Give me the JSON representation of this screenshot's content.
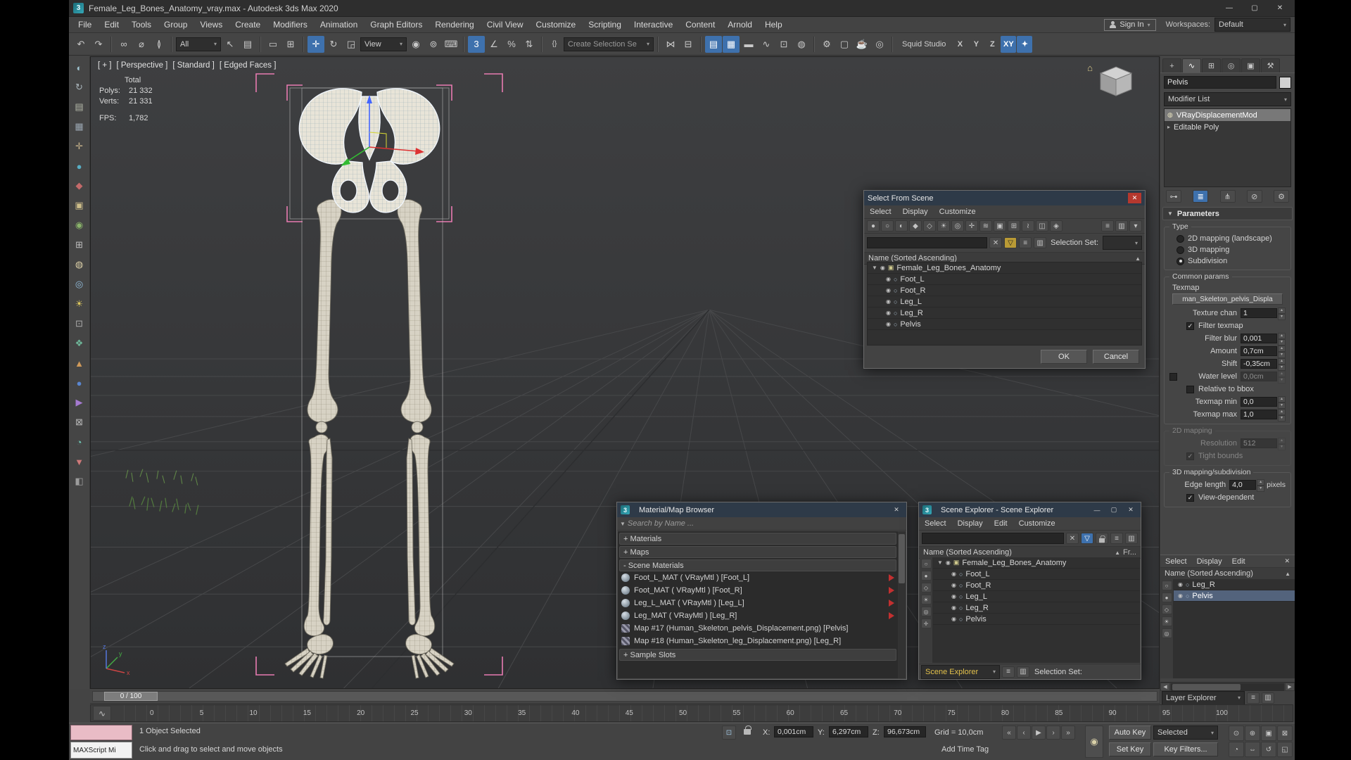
{
  "icons": {
    "eye": "◉",
    "obj": "○",
    "expand": "▼",
    "expand_right": "▸",
    "close": "✕",
    "min": "—",
    "max": "▢",
    "combo_arrow": "▾",
    "clear": "✕",
    "funnel": "▽",
    "check": "✓",
    "spin_up": "▴",
    "spin_down": "▾",
    "sort_asc": "▲",
    "hierarchy": "▣",
    "home": "⌂",
    "bulb": "◍",
    "hamburger": "≡",
    "columns": "▥",
    "left": "◀",
    "right": "▶",
    "braces": "{}",
    "curve": "∿",
    "app_badge": "3"
  },
  "titlebar": {
    "title": "Female_Leg_Bones_Anatomy_vray.max - Autodesk 3ds Max 2020"
  },
  "menubar": {
    "items": [
      "File",
      "Edit",
      "Tools",
      "Group",
      "Views",
      "Create",
      "Modifiers",
      "Animation",
      "Graph Editors",
      "Rendering",
      "Civil View",
      "Customize",
      "Scripting",
      "Interactive",
      "Content",
      "Arnold",
      "Help"
    ],
    "sign_in": "Sign In",
    "workspaces_label": "Workspaces:",
    "workspace": "Default"
  },
  "toolbar": {
    "history": [
      {
        "name": "undo-icon",
        "glyph": "↶"
      },
      {
        "name": "redo-icon",
        "glyph": "↷"
      }
    ],
    "link": [
      {
        "name": "select-and-link-icon",
        "glyph": "∞"
      },
      {
        "name": "unlink-selection-icon",
        "glyph": "⌀"
      },
      {
        "name": "bind-to-space-warp-icon",
        "glyph": "≬"
      }
    ],
    "selection_filter": "All",
    "select": [
      {
        "name": "select-object-icon",
        "glyph": "↖"
      },
      {
        "name": "select-by-name-icon",
        "glyph": "▤"
      }
    ],
    "region": [
      {
        "name": "rectangular-selection-icon",
        "glyph": "▭"
      },
      {
        "name": "window-crossing-icon",
        "glyph": "⊞"
      }
    ],
    "transform": [
      {
        "name": "select-and-move-icon",
        "glyph": "✛",
        "active": true
      },
      {
        "name": "select-and-rotate-icon",
        "glyph": "↻"
      },
      {
        "name": "select-and-scale-icon",
        "glyph": "◲"
      }
    ],
    "ref_coord": "View",
    "pivot": [
      {
        "name": "use-pivot-center-icon",
        "glyph": "◉"
      },
      {
        "name": "select-and-manipulate-icon",
        "glyph": "⊚"
      },
      {
        "name": "keyboard-override-icon",
        "glyph": "⌨"
      }
    ],
    "snaps": [
      {
        "name": "snap-toggle-3d-icon",
        "glyph": "3",
        "active": true
      },
      {
        "name": "angle-snap-icon",
        "glyph": "∠"
      },
      {
        "name": "percent-snap-icon",
        "glyph": "%"
      },
      {
        "name": "spinner-snap-icon",
        "glyph": "⇅"
      }
    ],
    "named_sets_glyph": "{}",
    "selection_set_placeholder": "Create Selection Se",
    "mirror_align": [
      {
        "name": "mirror-icon",
        "glyph": "⋈"
      },
      {
        "name": "align-icon",
        "glyph": "⊟"
      }
    ],
    "toggles": [
      {
        "name": "toggle-scene-explorer-icon",
        "glyph": "▤",
        "active": true
      },
      {
        "name": "toggle-layer-explorer-icon",
        "glyph": "▦",
        "active": true
      },
      {
        "name": "toggle-ribbon-icon",
        "glyph": "▬"
      },
      {
        "name": "curve-editor-icon",
        "glyph": "∿"
      },
      {
        "name": "schematic-view-icon",
        "glyph": "⊡"
      },
      {
        "name": "material-editor-icon",
        "glyph": "◍"
      }
    ],
    "render": [
      {
        "name": "render-setup-icon",
        "glyph": "⚙"
      },
      {
        "name": "rendered-frame-window-icon",
        "glyph": "▢"
      },
      {
        "name": "render-production-icon",
        "glyph": "☕"
      },
      {
        "name": "render-iterative-icon",
        "glyph": "◎"
      }
    ],
    "studio_label": "Squid Studio",
    "axis": [
      {
        "name": "axis-x-button",
        "label": "X"
      },
      {
        "name": "axis-y-button",
        "label": "Y"
      },
      {
        "name": "axis-z-button",
        "label": "Z"
      },
      {
        "name": "axis-xy-button",
        "label": "XY",
        "active": true
      },
      {
        "name": "axis-xyz-icon",
        "label": "✦",
        "active": true
      }
    ]
  },
  "left_tools": [
    {
      "name": "left-tool-select-icon",
      "glyph": "◐",
      "color": "#9fc3cf"
    },
    {
      "name": "left-tool-refresh-icon",
      "glyph": "↻",
      "color": "#a9b4ba"
    },
    {
      "name": "left-tool-layers-icon",
      "glyph": "▤",
      "color": "#b3b8a8"
    },
    {
      "name": "left-tool-grid-icon",
      "glyph": "▦",
      "color": "#9aa6b1"
    },
    {
      "name": "left-tool-add-icon",
      "glyph": "✛",
      "color": "#c3b089"
    },
    {
      "name": "left-tool-sphere-icon",
      "glyph": "●",
      "color": "#58aec4"
    },
    {
      "name": "left-tool-material-icon",
      "glyph": "◆",
      "color": "#c46a6a"
    },
    {
      "name": "left-tool-box-icon",
      "glyph": "▣",
      "color": "#cdbd8a"
    },
    {
      "name": "left-tool-target-icon",
      "glyph": "◉",
      "color": "#8ab46a"
    },
    {
      "name": "left-tool-window-icon",
      "glyph": "⊞",
      "color": "#bdbdbd"
    },
    {
      "name": "left-tool-render-icon",
      "glyph": "◍",
      "color": "#dcd0a8"
    },
    {
      "name": "left-tool-camera-icon",
      "glyph": "◎",
      "color": "#93bede"
    },
    {
      "name": "left-tool-light-icon",
      "glyph": "☀",
      "color": "#dec85e"
    },
    {
      "name": "left-tool-plane-icon",
      "glyph": "⊡",
      "color": "#ababab"
    },
    {
      "name": "left-tool-star-icon",
      "glyph": "❖",
      "color": "#6fb89a"
    },
    {
      "name": "left-tool-up-icon",
      "glyph": "▲",
      "color": "#d09a5a"
    },
    {
      "name": "left-tool-dot-icon",
      "glyph": "●",
      "color": "#5a86d0"
    },
    {
      "name": "left-tool-play-icon",
      "glyph": "▶",
      "color": "#a57ad0"
    },
    {
      "name": "left-tool-close-icon",
      "glyph": "⊠",
      "color": "#b8b8b8"
    },
    {
      "name": "left-tool-quarter-icon",
      "glyph": "◔",
      "color": "#72cfbc"
    },
    {
      "name": "left-tool-down-icon",
      "glyph": "▼",
      "color": "#cf7a7a"
    },
    {
      "name": "left-tool-half-icon",
      "glyph": "◧",
      "color": "#9c9c9c"
    }
  ],
  "viewport": {
    "label_plus": "[ + ]",
    "label_persp": "[ Perspective ]",
    "label_standard": "[ Standard ]",
    "label_edged": "[ Edged Faces ]",
    "stats_total_label": "Total",
    "stats_polys_label": "Polys:",
    "stats_polys": "21 332",
    "stats_verts_label": "Verts:",
    "stats_verts": "21 331",
    "stats_fps_label": "FPS:",
    "stats_fps": "1,782"
  },
  "dialogs": {
    "sfs": {
      "title": "Select From Scene",
      "menus": [
        "Select",
        "Display",
        "Customize"
      ],
      "toolbar": [
        {
          "name": "display-all-icon",
          "glyph": "●"
        },
        {
          "name": "display-none-icon",
          "glyph": "○"
        },
        {
          "name": "display-invert-icon",
          "glyph": "◐"
        },
        {
          "name": "display-geometry-icon",
          "glyph": "◆"
        },
        {
          "name": "display-shapes-icon",
          "glyph": "◇"
        },
        {
          "name": "display-lights-icon",
          "glyph": "☀"
        },
        {
          "name": "display-cameras-icon",
          "glyph": "◎"
        },
        {
          "name": "display-helpers-icon",
          "glyph": "✛"
        },
        {
          "name": "display-space-warps-icon",
          "glyph": "≋"
        },
        {
          "name": "display-groups-icon",
          "glyph": "▣"
        },
        {
          "name": "display-xrefs-icon",
          "glyph": "⊞"
        },
        {
          "name": "display-bones-icon",
          "glyph": "≀"
        },
        {
          "name": "display-containers-icon",
          "glyph": "◫"
        },
        {
          "name": "display-frozen-icon",
          "glyph": "◈"
        }
      ],
      "toolbar_right": [
        {
          "name": "sfs-settings-icon",
          "glyph": "≡"
        },
        {
          "name": "sfs-columns-icon",
          "glyph": "▥"
        },
        {
          "name": "sfs-pick-icon",
          "glyph": "▾"
        }
      ],
      "selection_set_label": "Selection Set:",
      "header": "Name (Sorted Ascending)",
      "root": "Female_Leg_Bones_Anatomy",
      "children": [
        {
          "label": "Foot_L"
        },
        {
          "label": "Foot_R"
        },
        {
          "label": "Leg_L"
        },
        {
          "label": "Leg_R"
        },
        {
          "label": "Pelvis"
        }
      ],
      "ok": "OK",
      "cancel": "Cancel"
    },
    "mat": {
      "title": "Material/Map Browser",
      "search": "Search by Name ...",
      "sec_materials": "+ Materials",
      "sec_maps": "+ Maps",
      "sec_scene": "- Scene Materials",
      "sec_slots": "+ Sample Slots",
      "rows": [
        {
          "label": "Foot_L_MAT ( VRayMtl ) [Foot_L]",
          "vray": true
        },
        {
          "label": "Foot_MAT ( VRayMtl ) [Foot_R]",
          "vray": true
        },
        {
          "label": "Leg_L_MAT ( VRayMtl ) [Leg_L]",
          "vray": true
        },
        {
          "label": "Leg_MAT ( VRayMtl ) [Leg_R]",
          "vray": true
        },
        {
          "label": "Map #17 (Human_Skeleton_pelvis_Displacement.png) [Pelvis]",
          "map": true
        },
        {
          "label": "Map #18 (Human_Skeleton_leg_Displacement.png) [Leg_R]",
          "map": true
        }
      ]
    },
    "se": {
      "title": "Scene Explorer - Scene Explorer",
      "menus": [
        "Select",
        "Display",
        "Edit",
        "Customize"
      ],
      "header": "Name (Sorted Ascending)",
      "col2": "Fr...",
      "strip": [
        {
          "name": "se-display-none-icon",
          "glyph": "○"
        },
        {
          "name": "se-display-geometry-icon",
          "glyph": "●"
        },
        {
          "name": "se-display-shapes-icon",
          "glyph": "◇"
        },
        {
          "name": "se-display-lights-icon",
          "glyph": "☀"
        },
        {
          "name": "se-display-cameras-icon",
          "glyph": "◎"
        },
        {
          "name": "se-display-helpers-icon",
          "glyph": "✛"
        }
      ],
      "root": "Female_Leg_Bones_Anatomy",
      "children": [
        {
          "label": "Foot_L"
        },
        {
          "label": "Foot_R"
        },
        {
          "label": "Leg_L"
        },
        {
          "label": "Leg_R"
        },
        {
          "label": "Pelvis"
        }
      ],
      "bottom_combo": "Scene Explorer",
      "selection_set_label": "Selection Set:"
    }
  },
  "command_panel": {
    "tabs": [
      {
        "name": "tab-create-icon",
        "glyph": "+"
      },
      {
        "name": "tab-modify-icon",
        "glyph": "∿",
        "active": true
      },
      {
        "name": "tab-hierarchy-icon",
        "glyph": "⊞"
      },
      {
        "name": "tab-motion-icon",
        "glyph": "◎"
      },
      {
        "name": "tab-display-icon",
        "glyph": "▣"
      },
      {
        "name": "tab-utilities-icon",
        "glyph": "⚒"
      }
    ],
    "object_name": "Pelvis",
    "modifier_list_label": "Modifier List",
    "stack_row1": "VRayDisplacementMod",
    "stack_row2": "Editable Poly",
    "stack_buttons": [
      {
        "name": "pin-stack-icon",
        "glyph": "⊶"
      },
      {
        "name": "show-end-result-icon",
        "glyph": "≣",
        "active": true
      },
      {
        "name": "make-unique-icon",
        "glyph": "⋔"
      },
      {
        "name": "remove-modifier-icon",
        "glyph": "⊘"
      },
      {
        "name": "configure-modifier-sets-icon",
        "glyph": "⚙"
      }
    ]
  },
  "params": {
    "rollout": "Parameters",
    "type_label": "Type",
    "type_2d": "2D mapping (landscape)",
    "type_3d": "3D mapping",
    "type_sub": "Subdivision",
    "common_label": "Common params",
    "texmap_label": "Texmap",
    "texmap_btn": "man_Skeleton_pelvis_Displa",
    "texture_chan_label": "Texture chan",
    "texture_chan": "1",
    "filter_texmap": "Filter texmap",
    "filter_blur_label": "Filter blur",
    "filter_blur": "0,001",
    "amount_label": "Amount",
    "amount": "0,7cm",
    "shift_label": "Shift",
    "shift": "-0,35cm",
    "water_label": "Water level",
    "water": "0,0cm",
    "relative_bbox": "Relative to bbox",
    "texmap_min_label": "Texmap min",
    "texmap_min": "0,0",
    "texmap_max_label": "Texmap max",
    "texmap_max": "1,0",
    "mapping2d_label": "2D mapping",
    "resolution_label": "Resolution",
    "resolution": "512",
    "tight_bounds": "Tight bounds",
    "mapping3d_label": "3D mapping/subdivision",
    "edge_label": "Edge length",
    "edge": "4,0",
    "edge_unit": "pixels",
    "view_dependent": "View-dependent"
  },
  "dock": {
    "menus": [
      "Select",
      "Display",
      "Edit"
    ],
    "header": "Name (Sorted Ascending)",
    "strip": [
      {
        "name": "dock-display-none-icon",
        "glyph": "○"
      },
      {
        "name": "dock-display-geometry-icon",
        "glyph": "●"
      },
      {
        "name": "dock-display-shapes-icon",
        "glyph": "◇"
      },
      {
        "name": "dock-display-lights-icon",
        "glyph": "☀"
      },
      {
        "name": "dock-display-cameras-icon",
        "glyph": "◎"
      }
    ],
    "rows": [
      {
        "label": "Leg_R"
      },
      {
        "label": "Pelvis",
        "selected": true
      }
    ],
    "layer_combo": "Layer Explorer"
  },
  "timeline": {
    "slider_value": "0 / 100",
    "ticks": [
      "0",
      "5",
      "10",
      "15",
      "20",
      "25",
      "30",
      "35",
      "40",
      "45",
      "50",
      "55",
      "60",
      "65",
      "70",
      "75",
      "80",
      "85",
      "90",
      "95",
      "100"
    ]
  },
  "statusbar": {
    "maxscript": "MAXScript Mi",
    "selected": "1 Object Selected",
    "prompt": "Click and drag to select and move objects",
    "x_label": "X:",
    "x": "0,001cm",
    "y_label": "Y:",
    "y": "6,297cm",
    "z_label": "Z:",
    "z": "96,673cm",
    "grid": "Grid = 10,0cm",
    "add_time_tag": "Add Time Tag",
    "auto_key": "Auto Key",
    "selected_combo": "Selected",
    "set_key": "Set Key",
    "key_filters": "Key Filters...",
    "set_keys_glyph": "◉",
    "playback": [
      {
        "name": "go-to-start-button",
        "glyph": "«"
      },
      {
        "name": "previous-frame-button",
        "glyph": "‹"
      },
      {
        "name": "play-button",
        "glyph": "▶"
      },
      {
        "name": "next-frame-button",
        "glyph": "›"
      },
      {
        "name": "go-to-end-button",
        "glyph": "»"
      }
    ],
    "nav": [
      {
        "name": "zoom-icon",
        "glyph": "⊙"
      },
      {
        "name": "zoom-all-icon",
        "glyph": "⊕"
      },
      {
        "name": "zoom-extents-icon",
        "glyph": "▣"
      },
      {
        "name": "zoom-extents-all-icon",
        "glyph": "⊠"
      },
      {
        "name": "field-of-view-icon",
        "glyph": "◔"
      },
      {
        "name": "pan-icon",
        "glyph": "⇔"
      },
      {
        "name": "orbit-icon",
        "glyph": "↺"
      },
      {
        "name": "maximize-viewport-icon",
        "glyph": "◱"
      }
    ]
  }
}
